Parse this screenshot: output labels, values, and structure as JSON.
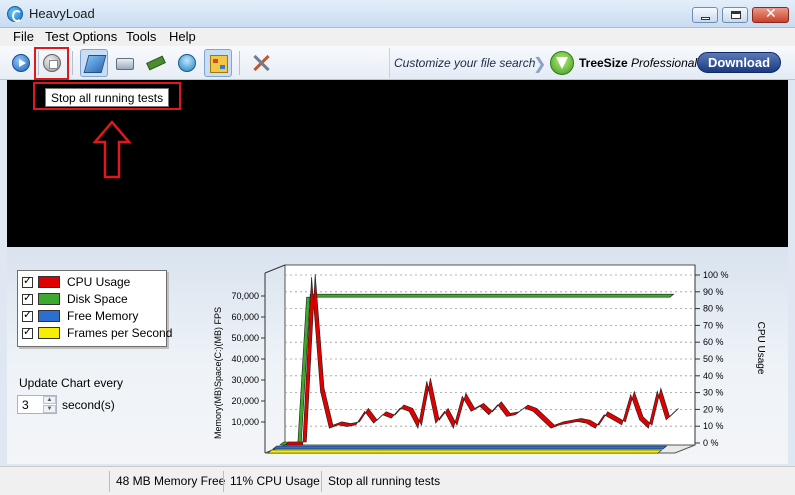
{
  "window": {
    "title": "HeavyLoad"
  },
  "menu": [
    "File",
    "Test Options",
    "Tools",
    "Help"
  ],
  "toolbar": {
    "tooltip": "Stop all running tests",
    "ad": {
      "text": "Customize your file search",
      "brand_bold": "TreeSize",
      "brand_italic": "Professional",
      "download": "Download"
    }
  },
  "legend": [
    {
      "label": "CPU Usage",
      "color": "#e10000",
      "checked": true
    },
    {
      "label": "Disk Space",
      "color": "#3daa2f",
      "checked": true
    },
    {
      "label": "Free Memory",
      "color": "#2b6fd0",
      "checked": true
    },
    {
      "label": "Frames per Second",
      "color": "#f4f000",
      "checked": true
    }
  ],
  "update": {
    "label": "Update Chart every",
    "value": "3",
    "unit": "second(s)"
  },
  "chart_data": {
    "type": "line",
    "left_axis_title": "Memory(MB)Space(C:)(MB) FPS",
    "right_axis_title": "CPU Usage",
    "left_ticks": [
      "10,000",
      "20,000",
      "30,000",
      "40,000",
      "50,000",
      "60,000",
      "70,000"
    ],
    "right_ticks": [
      "0 %",
      "10 %",
      "20 %",
      "30 %",
      "40 %",
      "50 %",
      "60 %",
      "70 %",
      "80 %",
      "90 %",
      "100 %"
    ],
    "ylim_right": [
      0,
      100
    ],
    "grid": true,
    "series": [
      {
        "name": "CPU Usage",
        "color": "#e10000",
        "values": [
          0,
          0,
          0,
          100,
          32,
          10,
          12,
          11,
          12,
          20,
          13,
          18,
          16,
          22,
          20,
          10,
          38,
          13,
          20,
          10,
          29,
          20,
          23,
          18,
          24,
          17,
          18,
          22,
          20,
          15,
          10,
          12,
          13,
          14,
          13,
          10,
          18,
          15,
          12,
          30,
          15,
          10,
          32,
          15,
          20
        ]
      },
      {
        "name": "Disk Space",
        "color": "#3daa2f",
        "values": [
          0,
          0,
          0,
          88,
          88,
          88,
          88,
          88,
          88,
          88,
          88,
          88,
          88,
          88,
          88,
          88,
          88,
          88,
          88,
          88,
          88,
          88,
          88,
          88,
          88,
          88,
          88,
          88,
          88,
          88,
          88,
          88,
          88,
          88,
          88,
          88,
          88,
          88,
          88,
          88,
          88,
          88,
          88,
          88,
          88
        ]
      },
      {
        "name": "Free Memory",
        "color": "#2b6fd0",
        "values": [
          0,
          0,
          0,
          0,
          0,
          0,
          0,
          0,
          0,
          0,
          0,
          0,
          0,
          0,
          0,
          0,
          0,
          0,
          0,
          0,
          0,
          0,
          0,
          0,
          0,
          0,
          0,
          0,
          0,
          0,
          0,
          0,
          0,
          0,
          0,
          0,
          0,
          0,
          0,
          0,
          0,
          0,
          0,
          0,
          0
        ]
      },
      {
        "name": "Frames per Second",
        "color": "#f4f000",
        "values": [
          0,
          0,
          0,
          0,
          0,
          0,
          0,
          0,
          0,
          0,
          0,
          0,
          0,
          0,
          0,
          0,
          0,
          0,
          0,
          0,
          0,
          0,
          0,
          0,
          0,
          0,
          0,
          0,
          0,
          0,
          0,
          0,
          0,
          0,
          0,
          0,
          0,
          0,
          0,
          0,
          0,
          0,
          0,
          0,
          0
        ]
      }
    ]
  },
  "status": {
    "memory": "48 MB Memory Free",
    "cpu": "11% CPU Usage",
    "message": "Stop all running tests"
  }
}
